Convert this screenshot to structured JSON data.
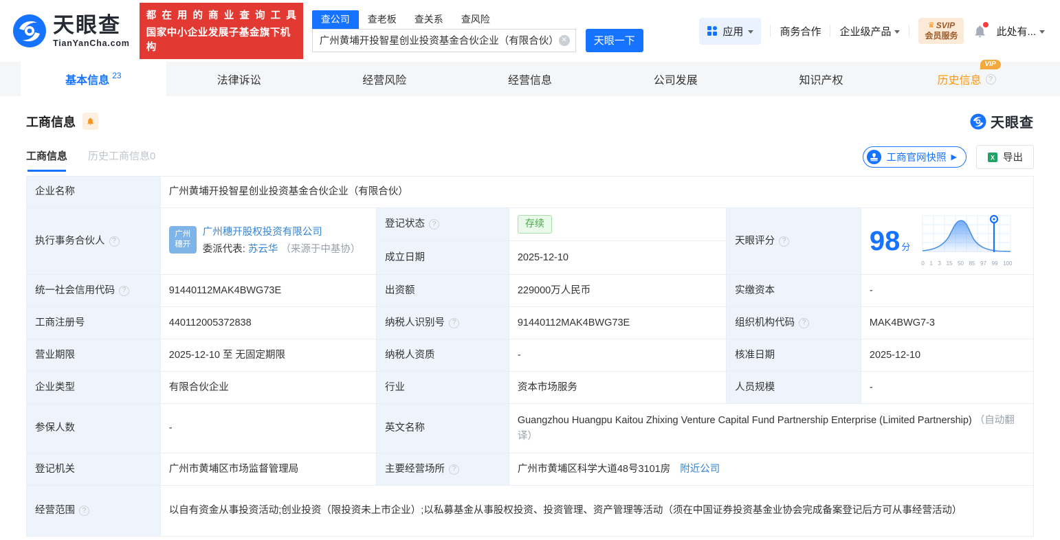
{
  "colors": {
    "accent": "#1673ff",
    "banner_red": "#e23a33",
    "orange": "#ff9502",
    "status_green": "#44ab44",
    "label_bg": "#eef4fb"
  },
  "header": {
    "logo": {
      "brand": "天眼查",
      "domain": "TianYanCha.com"
    },
    "banner": {
      "line1": "都在用的商业查询工具",
      "line2": "国家中小企业发展子基金旗下机构"
    },
    "search": {
      "tabs": [
        "查公司",
        "查老板",
        "查关系",
        "查风险"
      ],
      "value": "广州黄埔开投智星创业投资基金合伙企业（有限合伙）",
      "button": "天眼一下"
    },
    "menu": {
      "apps": "应用",
      "cooperation": "商务合作",
      "enterprise": "企业级产品",
      "svip_line1": "SVIP",
      "svip_line2": "会员服务",
      "user": "此处有..."
    }
  },
  "nav": {
    "vip": "VIP",
    "tabs": [
      {
        "label": "基本信息",
        "count": "23"
      },
      {
        "label": "法律诉讼"
      },
      {
        "label": "经营风险"
      },
      {
        "label": "经营信息"
      },
      {
        "label": "公司发展"
      },
      {
        "label": "知识产权"
      },
      {
        "label": "历史信息"
      }
    ]
  },
  "section": {
    "title": "工商信息",
    "watermark": "天眼查",
    "subtabs": [
      {
        "label": "工商信息"
      },
      {
        "label": "历史工商信息",
        "count": "0"
      }
    ],
    "snapshot_button": "工商官网快照",
    "export_button": "导出"
  },
  "table": {
    "company_name": {
      "label": "企业名称",
      "value": "广州黄埔开投智星创业投资基金合伙企业（有限合伙）"
    },
    "executive_partner": {
      "label": "执行事务合伙人",
      "avatar_line1": "广州",
      "avatar_line2": "穗开",
      "company": "广州穗开股权投资有限公司",
      "delegate_label": "委派代表: ",
      "delegate_name": "苏云华",
      "delegate_source": "（来源于中基协）"
    },
    "registration_status": {
      "label": "登记状态",
      "value": "存续"
    },
    "establish_date": {
      "label": "成立日期",
      "value": "2025-12-10"
    },
    "tyc_score": {
      "label": "天眼评分",
      "value": "98",
      "unit": "分"
    },
    "credit_code": {
      "label": "统一社会信用代码",
      "value": "91440112MAK4BWG73E"
    },
    "contribution": {
      "label": "出资额",
      "value": "229000万人民币"
    },
    "paid_in_capital": {
      "label": "实缴资本",
      "value": "-"
    },
    "reg_number": {
      "label": "工商注册号",
      "value": "440112005372838"
    },
    "taxpayer_id": {
      "label": "纳税人识别号",
      "value": "91440112MAK4BWG73E"
    },
    "org_code": {
      "label": "组织机构代码",
      "value": "MAK4BWG7-3"
    },
    "business_term": {
      "label": "营业期限",
      "value": "2025-12-10 至 无固定期限"
    },
    "taxpayer_quality": {
      "label": "纳税人资质",
      "value": "-"
    },
    "approval_date": {
      "label": "核准日期",
      "value": "2025-12-10"
    },
    "company_type": {
      "label": "企业类型",
      "value": "有限合伙企业"
    },
    "industry": {
      "label": "行业",
      "value": "资本市场服务"
    },
    "staff_size": {
      "label": "人员规模",
      "value": "-"
    },
    "insured_count": {
      "label": "参保人数",
      "value": "-"
    },
    "english_name": {
      "label": "英文名称",
      "value": "Guangzhou Huangpu Kaitou Zhixing Venture Capital Fund Partnership Enterprise (Limited Partnership)",
      "note": "（自动翻译）"
    },
    "registry_authority": {
      "label": "登记机关",
      "value": "广州市黄埔区市场监督管理局"
    },
    "business_address": {
      "label": "主要经营场所",
      "value": "广州市黄埔区科学大道48号3101房",
      "link": "附近公司"
    },
    "business_scope": {
      "label": "经营范围",
      "value": "以自有资金从事投资活动;创业投资（限投资未上市企业）;以私募基金从事股权投资、投资管理、资产管理等活动（须在中国证券投资基金业协会完成备案登记后方可从事经营活动）"
    }
  },
  "score_chart": {
    "type": "area",
    "description": "score distribution bell curve with marker at company score",
    "ticks": [
      "0",
      "1",
      "3",
      "15",
      "50",
      "85",
      "97",
      "99",
      "100"
    ],
    "marker_value": 98
  }
}
